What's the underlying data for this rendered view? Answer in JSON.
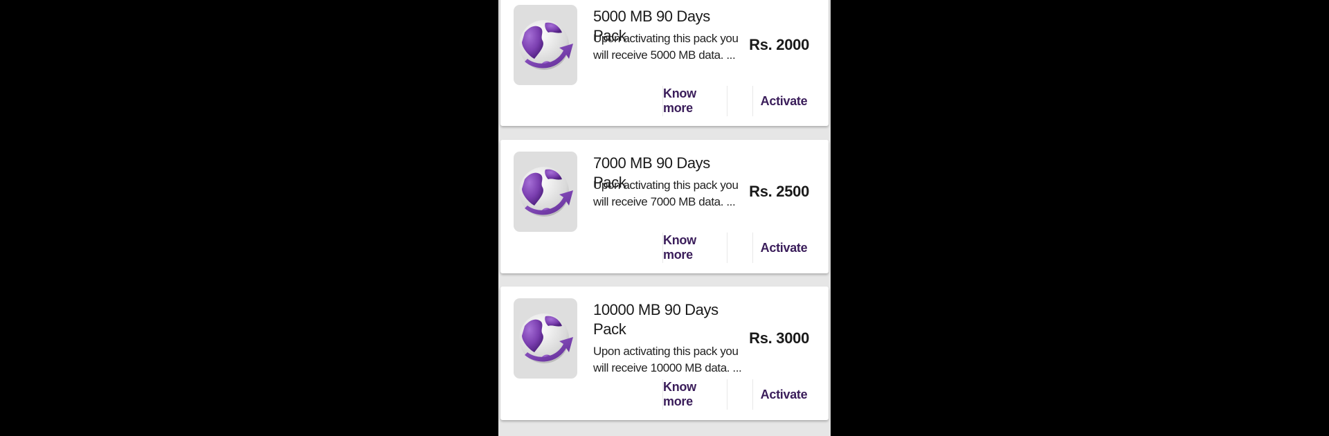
{
  "packs": [
    {
      "title": "5000 MB 90 Days Pack",
      "description_line1": "Upon activating this pack you",
      "description_line2": "will receive 5000 MB data. ...",
      "price": "Rs. 2000",
      "know_more_label": "Know more",
      "activate_label": "Activate",
      "icon": "globe-arrow-icon"
    },
    {
      "title": "7000 MB 90 Days Pack",
      "description_line1": "Upon activating this pack you",
      "description_line2": "will receive 7000 MB data. ...",
      "price": "Rs. 2500",
      "know_more_label": "Know more",
      "activate_label": "Activate",
      "icon": "globe-arrow-icon"
    },
    {
      "title": "10000 MB 90 Days Pack",
      "description_line1": "Upon activating this pack you",
      "description_line2": "will receive 10000 MB data. ...",
      "price": "Rs. 3000",
      "know_more_label": "Know more",
      "activate_label": "Activate",
      "icon": "globe-arrow-icon"
    }
  ],
  "colors": {
    "accent": "#3a1d5a",
    "globe_purple": "#7b3fb0",
    "background": "#e6e6e6",
    "card": "#ffffff"
  }
}
